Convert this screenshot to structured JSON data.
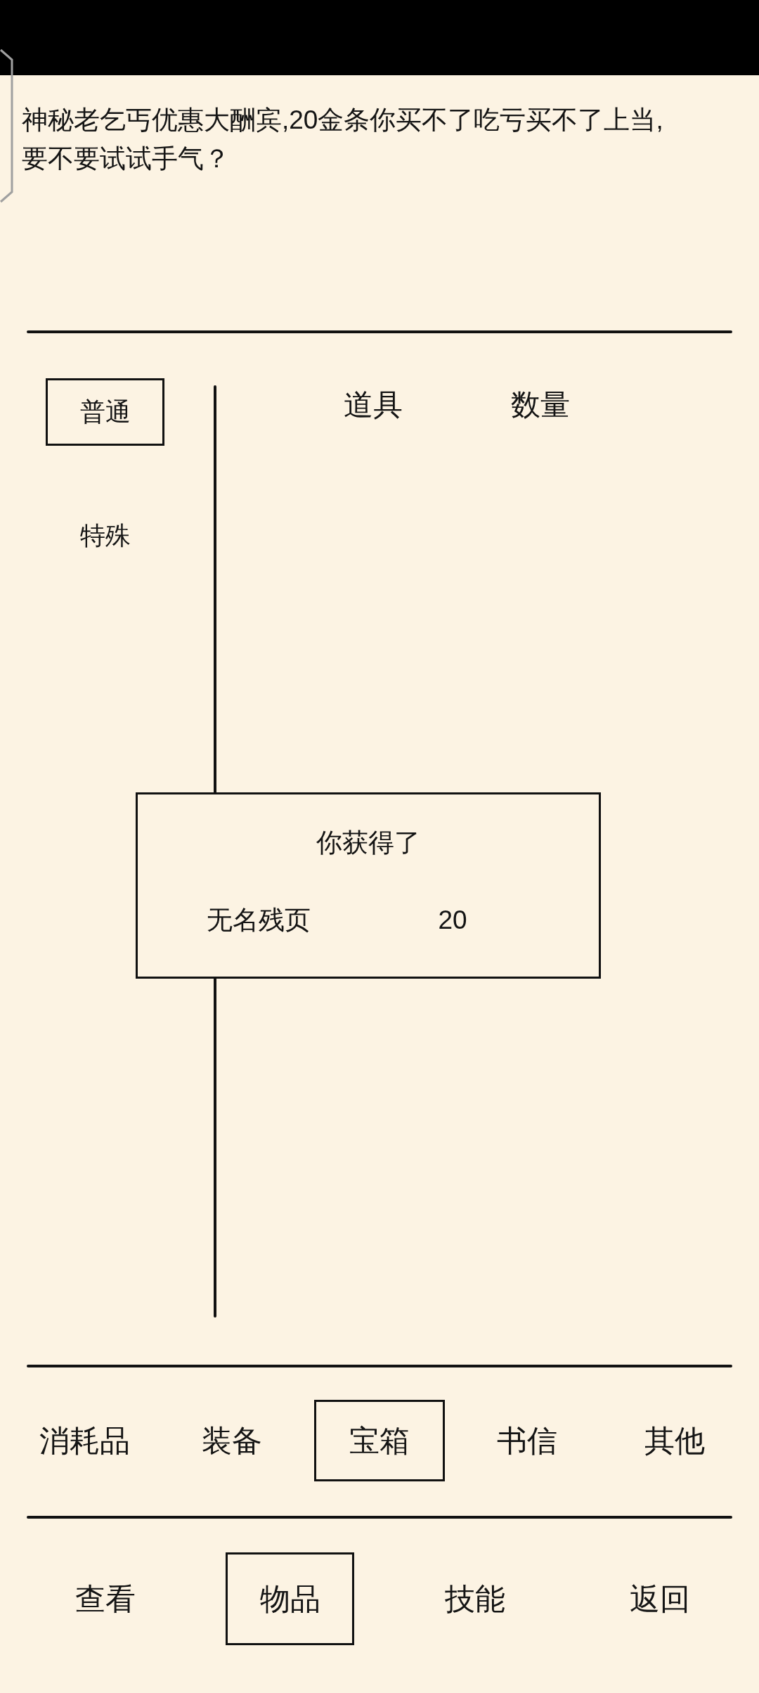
{
  "message": "神秘老乞丐优惠大酬宾,20金条你买不了吃亏买不了上当,\n要不要试试手气？",
  "subtabs": [
    {
      "label": "普通",
      "selected": true
    },
    {
      "label": "特殊",
      "selected": false
    }
  ],
  "table": {
    "columns": [
      "道具",
      "数量"
    ]
  },
  "dialog": {
    "title": "你获得了",
    "items": [
      {
        "name": "无名残页",
        "count": "20"
      }
    ]
  },
  "categories": [
    {
      "label": "消耗品",
      "selected": false
    },
    {
      "label": "装备",
      "selected": false
    },
    {
      "label": "宝箱",
      "selected": true
    },
    {
      "label": "书信",
      "selected": false
    },
    {
      "label": "其他",
      "selected": false
    }
  ],
  "nav": [
    {
      "label": "查看",
      "selected": false
    },
    {
      "label": "物品",
      "selected": true
    },
    {
      "label": "技能",
      "selected": false
    },
    {
      "label": "返回",
      "selected": false
    }
  ]
}
